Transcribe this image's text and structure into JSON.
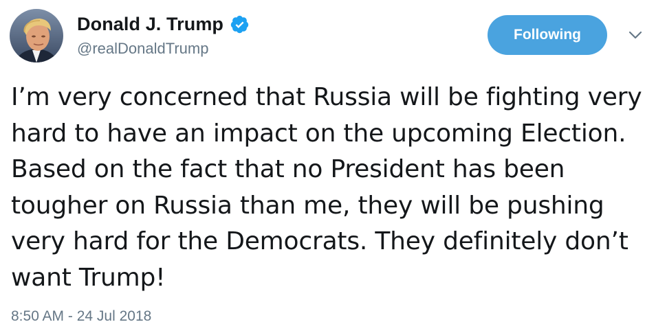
{
  "author": {
    "display_name": "Donald J. Trump",
    "handle": "@realDonaldTrump",
    "verified": true,
    "avatar_icon": "profile-photo",
    "verified_icon": "verified-badge-icon"
  },
  "actions": {
    "follow_label": "Following",
    "menu_icon": "chevron-down-icon"
  },
  "tweet": {
    "text": "I’m very concerned that Russia will be fighting very hard to have an impact on the upcoming Election. Based on the fact that no President has been tougher on Russia than me, they will be pushing very hard for the Democrats. They definitely don’t want Trump!",
    "timestamp": "8:50 AM - 24 Jul 2018"
  },
  "colors": {
    "accent": "#4aa3df",
    "verified": "#1da1f2",
    "text": "#14171a",
    "secondary_text": "#657786",
    "background": "#ffffff"
  }
}
